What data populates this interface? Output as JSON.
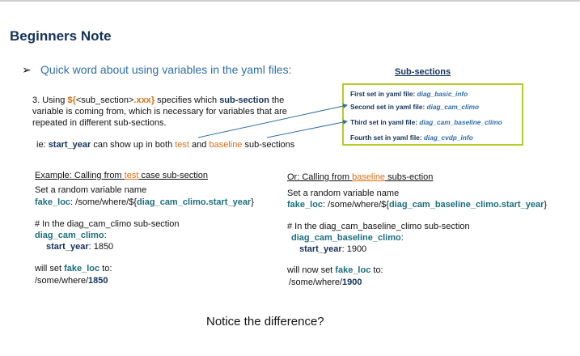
{
  "title": "Beginners Note",
  "bullet": {
    "arrow": "➢",
    "text": "Quick word about using variables in the yaml files:"
  },
  "subsections": {
    "heading": "Sub-sections",
    "items": [
      {
        "label": "First set in yaml file:",
        "value": "diag_basic_info"
      },
      {
        "label": "Second set in yaml file:",
        "value": "diag_cam_climo"
      },
      {
        "label": "Third set in yaml file:",
        "value": "diag_cam_baseline_climo"
      },
      {
        "label": "Fourth set in yaml file:",
        "value": "diag_cvdp_info"
      }
    ]
  },
  "explanation": {
    "prefix": "3.  Using ",
    "token_open": "${",
    "token_mid": "<sub_section>",
    "token_xxx": ".xxx",
    "token_close": "}",
    "middle": " specifies which ",
    "bold": "sub-section",
    "suffix": " the variable is coming from, which is necessary for variables that are repeated in different sub-sections."
  },
  "ie": {
    "prefix": "ie: ",
    "var": "start_year",
    "mid": " can show up in both ",
    "test": "test",
    "and": " and ",
    "baseline": "baseline",
    "suffix": " sub-sections"
  },
  "left_example": {
    "heading_a": "Example: Calling from ",
    "heading_b": "test",
    "heading_c": " case sub-section",
    "line1": "Set a random variable name",
    "var_name": "fake_loc",
    "path_prefix": ":  /some/where/${",
    "path_ref": "diag_cam_climo.start_year",
    "path_suffix": "}",
    "comment": "# In the diag_cam_climo sub-section",
    "section": "diag_cam_climo",
    "colon": ":",
    "key": "start_year",
    "val": ": 1850",
    "will_set_a": "will set ",
    "will_set_var": "fake_loc",
    "will_set_b": " to:",
    "result_prefix": "/some/where/",
    "result_bold": "1850"
  },
  "right_example": {
    "heading_a": "Or: Calling from ",
    "heading_b": "baseline",
    "heading_c": " subs-ection",
    "line1": "Set a random variable name",
    "var_name": "fake_loc",
    "path_prefix": ":  /some/where/${",
    "path_ref": "diag_cam_baseline_climo.start_year",
    "path_suffix": "}",
    "comment": "# In the diag_cam_baseline_climo sub-section",
    "section": "diag_cam_baseline_climo",
    "colon": ":",
    "key": "start_year",
    "val": ": 1900",
    "will_set_a": "will now set ",
    "will_set_var": "fake_loc",
    "will_set_b": " to:",
    "result_prefix": "/some/where/",
    "result_bold": "1900"
  },
  "notice": "Notice the difference?"
}
